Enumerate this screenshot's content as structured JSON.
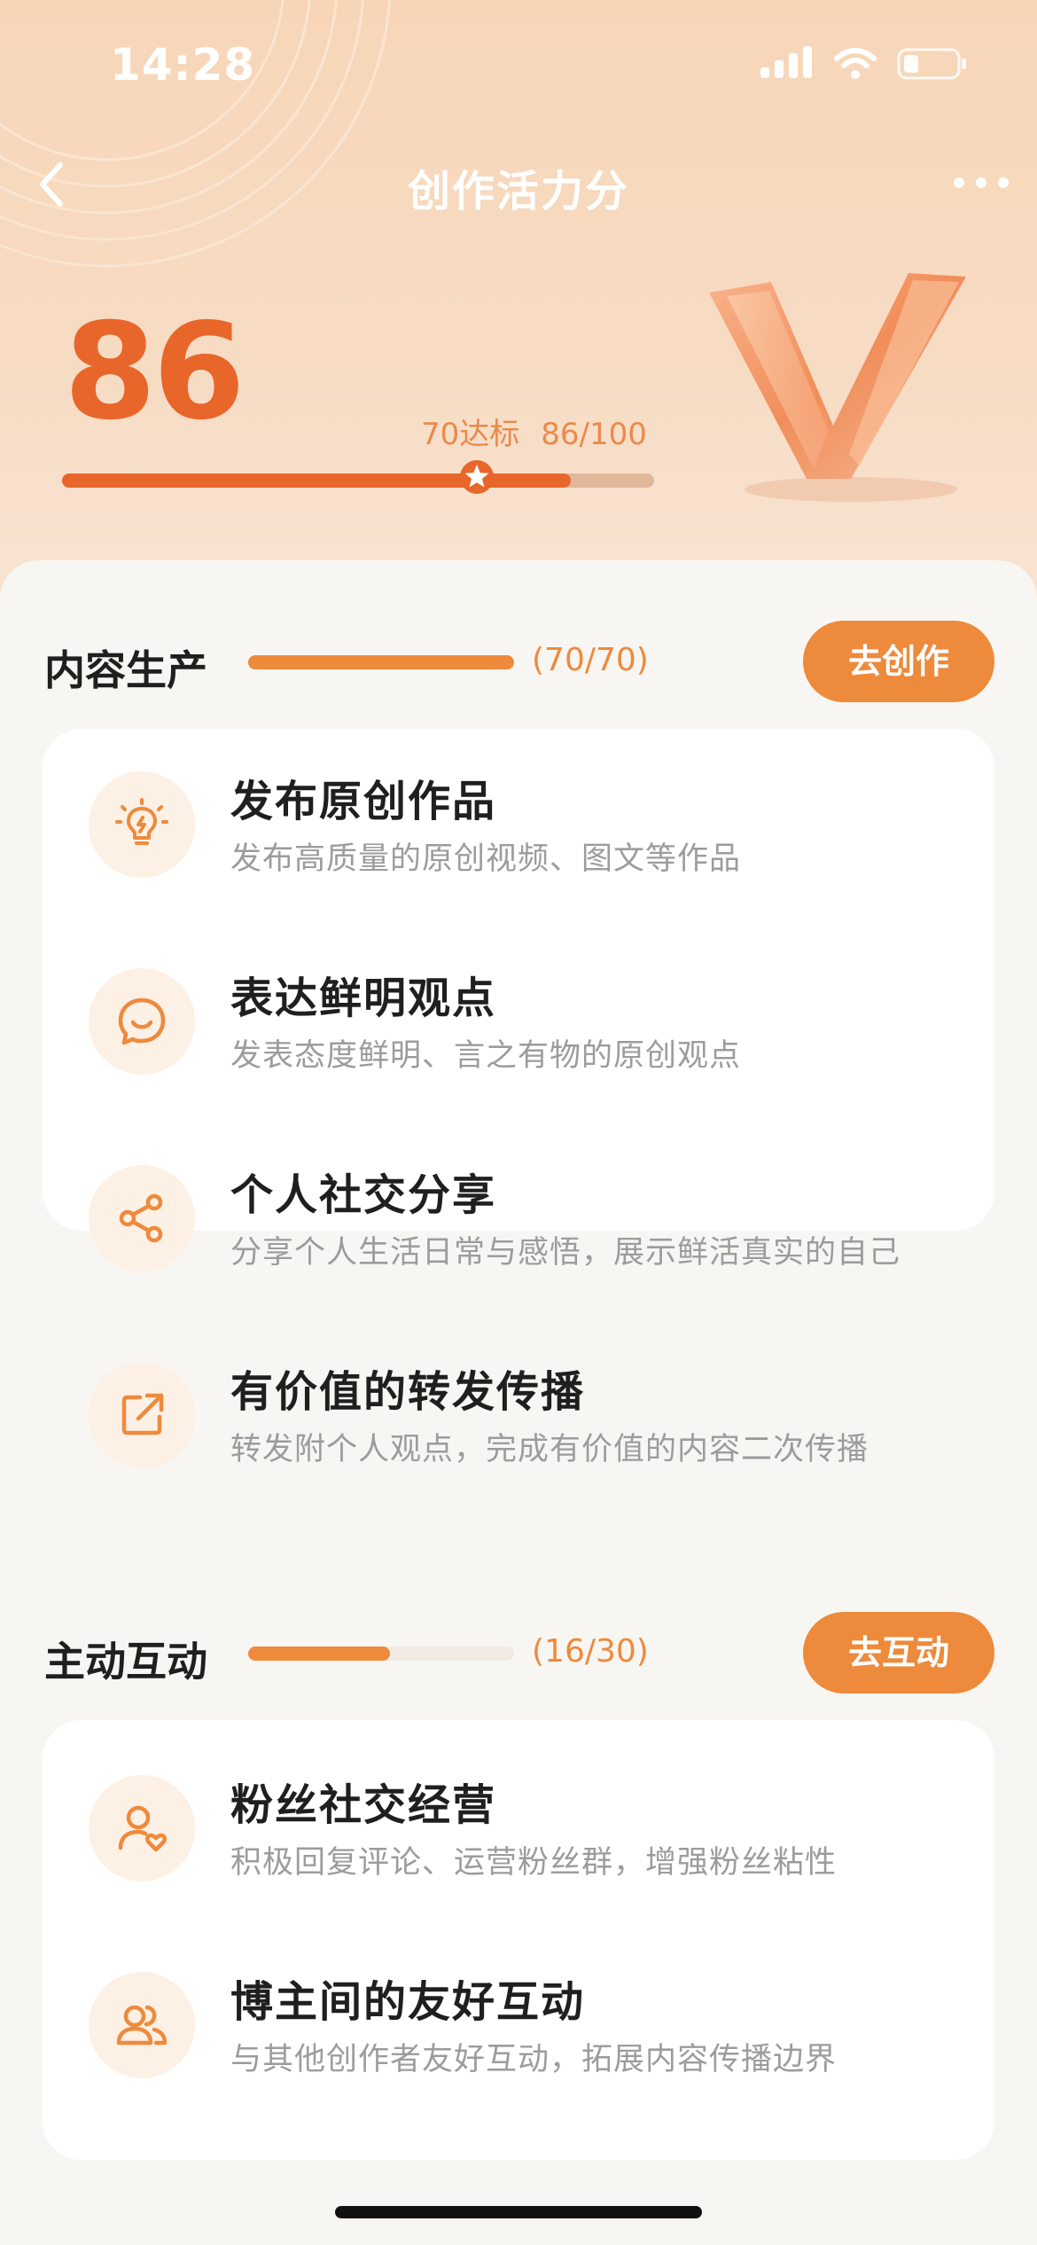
{
  "status_bar": {
    "time": "14:28"
  },
  "header": {
    "title": "创作活力分"
  },
  "score": {
    "value": "86",
    "target_label": "70达标",
    "progress_text": "86/100",
    "progress": 0.86,
    "target": 0.7
  },
  "sections": [
    {
      "title": "内容生产",
      "count": "(70/70)",
      "progress": 1.0,
      "button": "去创作",
      "items": [
        {
          "icon": "lightbulb-icon",
          "title": "发布原创作品",
          "desc": "发布高质量的原创视频、图文等作品"
        },
        {
          "icon": "chat-smile-icon",
          "title": "表达鲜明观点",
          "desc": "发表态度鲜明、言之有物的原创观点"
        },
        {
          "icon": "share-icon",
          "title": "个人社交分享",
          "desc": "分享个人生活日常与感悟，展示鲜活真实的自己"
        },
        {
          "icon": "forward-icon",
          "title": "有价值的转发传播",
          "desc": "转发附个人观点，完成有价值的内容二次传播"
        }
      ]
    },
    {
      "title": "主动互动",
      "count": "(16/30)",
      "progress": 0.533,
      "button": "去互动",
      "items": [
        {
          "icon": "user-heart-icon",
          "title": "粉丝社交经营",
          "desc": "积极回复评论、运营粉丝群，增强粉丝粘性"
        },
        {
          "icon": "users-icon",
          "title": "博主间的友好互动",
          "desc": "与其他创作者友好互动，拓展内容传播边界"
        }
      ]
    }
  ],
  "colors": {
    "accent": "#ee8a3c",
    "score": "#e8662a",
    "hero_bg": "#f7d6b8"
  }
}
